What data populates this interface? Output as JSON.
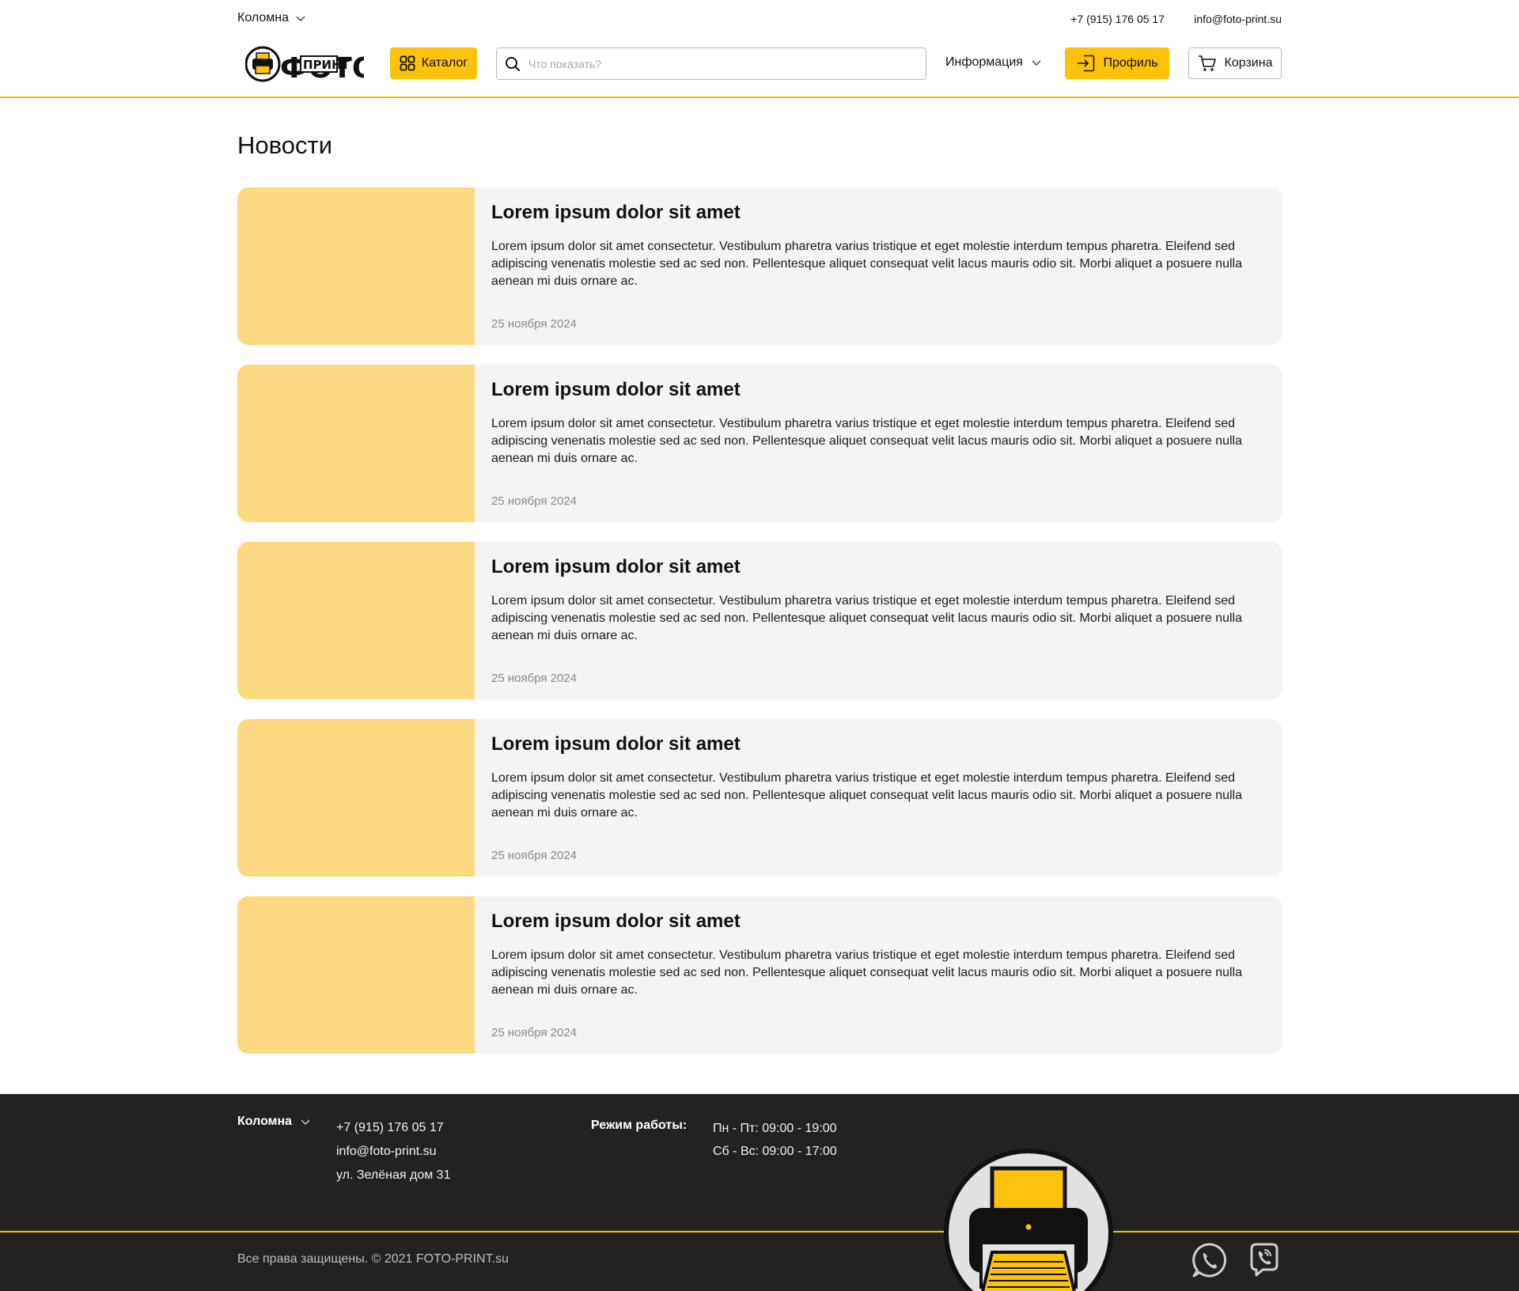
{
  "topbar": {
    "city": "Коломна",
    "phone": "+7 (915) 176 05 17",
    "email": "info@foto-print.su"
  },
  "header": {
    "logo_text_top": "ФОТО",
    "logo_text_mid": "ПРИНТ",
    "catalog_label": "Каталог",
    "search_placeholder": "Что показать?",
    "info_label": "Информация",
    "profile_label": "Профиль",
    "cart_label": "Корзина"
  },
  "main": {
    "title": "Новости",
    "news": [
      {
        "title": "Lorem ipsum dolor sit amet",
        "text": "Lorem ipsum dolor sit amet consectetur. Vestibulum pharetra varius tristique et eget molestie interdum tempus pharetra. Eleifend sed adipiscing venenatis molestie sed ac sed non. Pellentesque aliquet consequat velit lacus mauris odio sit. Morbi aliquet a posuere nulla aenean mi duis ornare ac.",
        "date": "25 ноября 2024"
      },
      {
        "title": "Lorem ipsum dolor sit amet",
        "text": "Lorem ipsum dolor sit amet consectetur. Vestibulum pharetra varius tristique et eget molestie interdum tempus pharetra. Eleifend sed adipiscing venenatis molestie sed ac sed non. Pellentesque aliquet consequat velit lacus mauris odio sit. Morbi aliquet a posuere nulla aenean mi duis ornare ac.",
        "date": "25 ноября 2024"
      },
      {
        "title": "Lorem ipsum dolor sit amet",
        "text": "Lorem ipsum dolor sit amet consectetur. Vestibulum pharetra varius tristique et eget molestie interdum tempus pharetra. Eleifend sed adipiscing venenatis molestie sed ac sed non. Pellentesque aliquet consequat velit lacus mauris odio sit. Morbi aliquet a posuere nulla aenean mi duis ornare ac.",
        "date": "25 ноября 2024"
      },
      {
        "title": "Lorem ipsum dolor sit amet",
        "text": "Lorem ipsum dolor sit amet consectetur. Vestibulum pharetra varius tristique et eget molestie interdum tempus pharetra. Eleifend sed adipiscing venenatis molestie sed ac sed non. Pellentesque aliquet consequat velit lacus mauris odio sit. Morbi aliquet a posuere nulla aenean mi duis ornare ac.",
        "date": "25 ноября 2024"
      },
      {
        "title": "Lorem ipsum dolor sit amet",
        "text": "Lorem ipsum dolor sit amet consectetur. Vestibulum pharetra varius tristique et eget molestie interdum tempus pharetra. Eleifend sed adipiscing venenatis molestie sed ac sed non. Pellentesque aliquet consequat velit lacus mauris odio sit. Morbi aliquet a posuere nulla aenean mi duis ornare ac.",
        "date": "25 ноября 2024"
      }
    ]
  },
  "footer": {
    "city": "Коломна",
    "phone": "+7 (915) 176 05 17",
    "email": "info@foto-print.su",
    "address": "ул. Зелёная дом 31",
    "hours_label": "Режим работы:",
    "hours_weekdays": "Пн - Пт: 09:00 - 19:00",
    "hours_weekend": "Сб - Вс: 09:00 - 17:00",
    "copyright": "Все права защищены. © 2021 FOTO-PRINT.su",
    "social": [
      "whatsapp-icon",
      "viber-icon"
    ]
  },
  "colors": {
    "accent": "#fcc20c",
    "accent_line": "#f5b800",
    "thumb": "#fdd981",
    "card_bg": "#f4f4f4",
    "footer_bg": "#222222"
  }
}
